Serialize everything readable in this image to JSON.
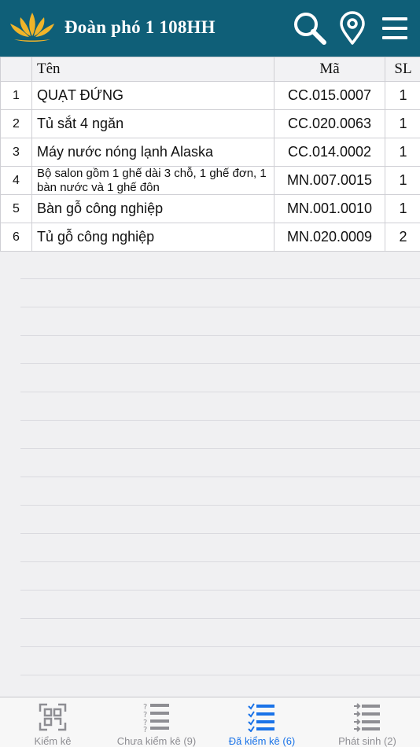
{
  "header": {
    "title": "Đoàn phó 1 108HH",
    "icons": [
      "lotus-logo-icon",
      "search-icon",
      "location-pin-icon",
      "hamburger-menu-icon"
    ]
  },
  "table": {
    "columns": [
      "",
      "Tên",
      "Mã",
      "SL"
    ],
    "rows": [
      {
        "idx": "1",
        "name": "QUẠT ĐỨNG",
        "code": "CC.015.0007",
        "qty": "1"
      },
      {
        "idx": "2",
        "name": "Tủ sắt 4 ngăn",
        "code": "CC.020.0063",
        "qty": "1"
      },
      {
        "idx": "3",
        "name": "Máy nước nóng lạnh Alaska",
        "code": "CC.014.0002",
        "qty": "1"
      },
      {
        "idx": "4",
        "name": "Bộ salon gồm 1 ghế dài 3 chỗ, 1 ghế đơn, 1 bàn nước và 1 ghế đôn",
        "code": "MN.007.0015",
        "qty": "1"
      },
      {
        "idx": "5",
        "name": "Bàn gỗ công nghiệp",
        "code": "MN.001.0010",
        "qty": "1"
      },
      {
        "idx": "6",
        "name": "Tủ gỗ công nghiệp",
        "code": "MN.020.0009",
        "qty": "2"
      }
    ]
  },
  "tabbar": {
    "tabs": [
      {
        "label": "Kiểm kê",
        "icon": "qr-scan-icon",
        "active": false
      },
      {
        "label": "Chưa kiểm kê (9)",
        "icon": "unchecked-list-icon",
        "active": false
      },
      {
        "label": "Đã kiểm kê (6)",
        "icon": "checked-list-icon",
        "active": true
      },
      {
        "label": "Phát sinh (2)",
        "icon": "arrow-list-icon",
        "active": false
      }
    ]
  },
  "colors": {
    "header_bg": "#0f5f78",
    "active_tab": "#1a73e8",
    "inactive_tab": "#8e8e93",
    "logo_gold": "#f0b429"
  }
}
